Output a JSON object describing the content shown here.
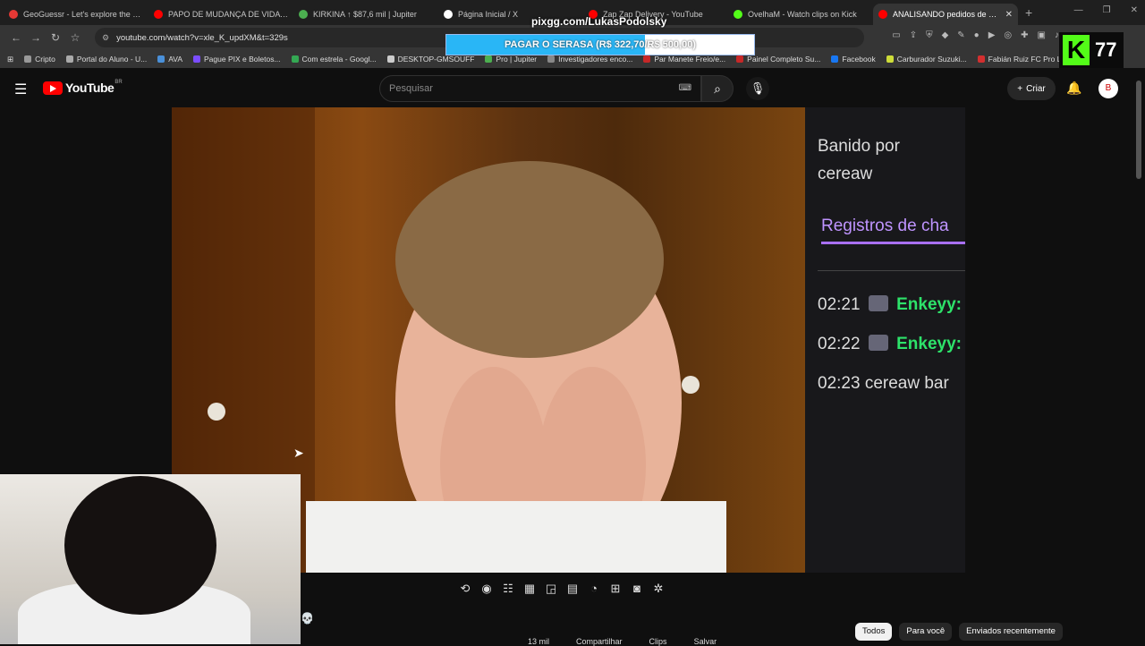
{
  "browser": {
    "tabs": [
      {
        "title": "GeoGuessr - Let's explore the world!",
        "color": "#e53935"
      },
      {
        "title": "PAPO DE MUDANÇA DE VIDA COM",
        "color": "#ff0000"
      },
      {
        "title": "KIRKINA ↑ $87,6 mil | Jupiter",
        "color": "#4caf50"
      },
      {
        "title": "Página Inicial / X",
        "color": "#ffffff"
      },
      {
        "title": "Zap Zap Delivery - YouTube",
        "color": "#ff0000"
      },
      {
        "title": "OvelhaM - Watch clips on Kick",
        "color": "#53fc18"
      },
      {
        "title": "ANALISANDO pedidos de UNB",
        "color": "#ff0000",
        "active": true
      }
    ],
    "url": "youtube.com/watch?v=xle_K_updXM&t=329s",
    "bookmarks": [
      {
        "label": "Cripto",
        "color": "#999"
      },
      {
        "label": "Portal do Aluno - U...",
        "color": "#aaa"
      },
      {
        "label": "AVA",
        "color": "#4a90d9"
      },
      {
        "label": "Pague PIX e Boletos...",
        "color": "#7b4dff"
      },
      {
        "label": "Com estrela - Googl...",
        "color": "#34a853"
      },
      {
        "label": "DESKTOP-GMSOUFF",
        "color": "#ccc"
      },
      {
        "label": "Pro | Jupiter",
        "color": "#4caf50"
      },
      {
        "label": "Investigadores enco...",
        "color": "#888"
      },
      {
        "label": "Par Manete Freio/e...",
        "color": "#c62828"
      },
      {
        "label": "Painel Completo Su...",
        "color": "#c62828"
      },
      {
        "label": "Facebook",
        "color": "#1877f2"
      },
      {
        "label": "Carburador Suzuki...",
        "color": "#cddc39"
      },
      {
        "label": "Fabián Ruiz FC Pro L...",
        "color": "#d32f2f"
      }
    ]
  },
  "overlay": {
    "pix_url": "pixgg.com/LukasPodolsky",
    "goal_text": "PAGAR O SERASA (R$ 322,70/R$ 500,00)",
    "goal_progress": 0.645,
    "kick_count": "77",
    "kick_logo": "K"
  },
  "youtube": {
    "logo": "YouTube",
    "country": "BR",
    "search_placeholder": "Pesquisar",
    "create_label": "Criar",
    "avatar_letter": "B",
    "chips": [
      "Todos",
      "Para você",
      "Enviados recentemente"
    ],
    "actions": [
      "13 mil",
      "Compartilhar",
      "Clips",
      "Salvar"
    ]
  },
  "chat": {
    "banned_line1": "Banido por",
    "banned_line2": "cereaw",
    "logs_label": "Registros de cha",
    "messages": [
      {
        "time": "02:21",
        "user": "Enkeyy:"
      },
      {
        "time": "02:22",
        "user": "Enkeyy:"
      },
      {
        "time": "02:23",
        "text": "cereaw bar"
      }
    ]
  }
}
